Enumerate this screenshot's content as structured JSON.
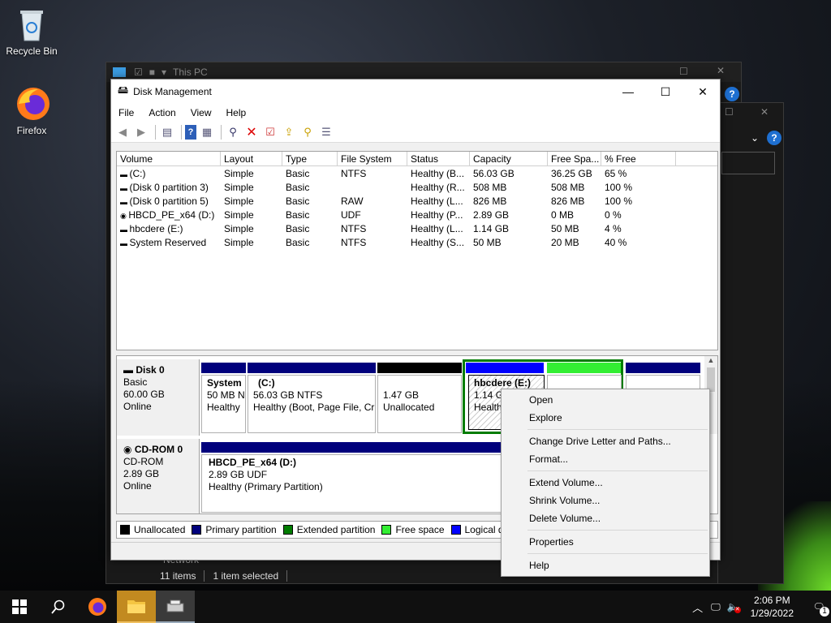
{
  "desktop": {
    "icons": [
      {
        "label": "Recycle Bin"
      },
      {
        "label": "Firefox"
      }
    ]
  },
  "explorer": {
    "title": "This PC",
    "status_items": "11 items",
    "status_selected": "1 item selected",
    "nav_item": "Network"
  },
  "disk_management": {
    "title": "Disk Management",
    "menu": [
      "File",
      "Action",
      "View",
      "Help"
    ],
    "columns": [
      "Volume",
      "Layout",
      "Type",
      "File System",
      "Status",
      "Capacity",
      "Free Spa...",
      "% Free"
    ],
    "volumes": [
      {
        "volume": "(C:)",
        "layout": "Simple",
        "type": "Basic",
        "fs": "NTFS",
        "status": "Healthy (B...",
        "capacity": "56.03 GB",
        "free": "36.25 GB",
        "pct": "65 %"
      },
      {
        "volume": "(Disk 0 partition 3)",
        "layout": "Simple",
        "type": "Basic",
        "fs": "",
        "status": "Healthy (R...",
        "capacity": "508 MB",
        "free": "508 MB",
        "pct": "100 %"
      },
      {
        "volume": "(Disk 0 partition 5)",
        "layout": "Simple",
        "type": "Basic",
        "fs": "RAW",
        "status": "Healthy (L...",
        "capacity": "826 MB",
        "free": "826 MB",
        "pct": "100 %"
      },
      {
        "volume": "HBCD_PE_x64 (D:)",
        "layout": "Simple",
        "type": "Basic",
        "fs": "UDF",
        "status": "Healthy (P...",
        "capacity": "2.89 GB",
        "free": "0 MB",
        "pct": "0 %"
      },
      {
        "volume": "hbcdere (E:)",
        "layout": "Simple",
        "type": "Basic",
        "fs": "NTFS",
        "status": "Healthy (L...",
        "capacity": "1.14 GB",
        "free": "50 MB",
        "pct": "4 %"
      },
      {
        "volume": "System Reserved",
        "layout": "Simple",
        "type": "Basic",
        "fs": "NTFS",
        "status": "Healthy (S...",
        "capacity": "50 MB",
        "free": "20 MB",
        "pct": "40 %"
      }
    ],
    "disk0": {
      "name": "Disk 0",
      "kind": "Basic",
      "size": "60.00 GB",
      "state": "Online",
      "p_system": {
        "name": "System",
        "size": "50 MB N",
        "status": "Healthy"
      },
      "p_c": {
        "name": "(C:)",
        "size": "56.03 GB NTFS",
        "status": "Healthy (Boot, Page File, Cr"
      },
      "p_unalloc": {
        "size": "1.47 GB",
        "status": "Unallocated"
      },
      "p_e": {
        "name": "hbcdere (E:)",
        "size": "1.14 GB",
        "status": "Health"
      }
    },
    "cdrom0": {
      "name": "CD-ROM 0",
      "kind": "CD-ROM",
      "size": "2.89 GB",
      "state": "Online",
      "p_d": {
        "name": "HBCD_PE_x64 (D:)",
        "size": "2.89 GB UDF",
        "status": "Healthy (Primary Partition)"
      }
    },
    "legend": [
      {
        "label": "Unallocated",
        "color": "#000000"
      },
      {
        "label": "Primary partition",
        "color": "#00007c"
      },
      {
        "label": "Extended partition",
        "color": "#007c00"
      },
      {
        "label": "Free space",
        "color": "#33ee33"
      },
      {
        "label": "Logical drive",
        "color": "#0000ff"
      }
    ]
  },
  "context_menu": {
    "open": "Open",
    "explore": "Explore",
    "change_letter": "Change Drive Letter and Paths...",
    "format": "Format...",
    "extend": "Extend Volume...",
    "shrink": "Shrink Volume...",
    "delete": "Delete Volume...",
    "properties": "Properties",
    "help": "Help"
  },
  "taskbar": {
    "time": "2:06 PM",
    "date": "1/29/2022",
    "notification_count": "1"
  }
}
